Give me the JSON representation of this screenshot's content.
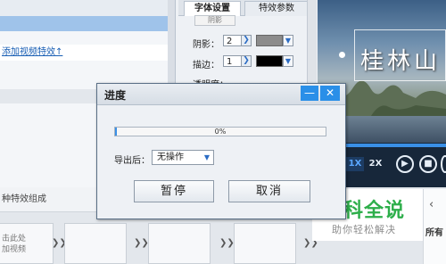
{
  "left_list": {
    "link_text": "添加视频特效↑"
  },
  "properties": {
    "tab_font": "字体设置",
    "tab_effect": "特效参数",
    "top_button": "阴影",
    "shadow_label": "阴影：",
    "shadow_value": "2",
    "shadow_color": "#8c8c8c",
    "stroke_label": "描边：",
    "stroke_value": "1",
    "stroke_color": "#000000",
    "opacity_label": "透明度："
  },
  "preview": {
    "title_text": "桂林山",
    "speed_1x": "1X",
    "speed_2x": "2X",
    "play_icon": "play-icon",
    "stop_icon": "stop-icon"
  },
  "bottom": {
    "effect_header": "种特效组成",
    "slot_hint": "击此处\n加视频"
  },
  "dialog": {
    "title": "进度",
    "progress_percent": 0,
    "progress_text": "0%",
    "after_label": "导出后：",
    "after_value": "无操作",
    "pause_button": "暂停",
    "cancel_button": "取消",
    "accent_color": "#2a8fe8"
  },
  "watermark": {
    "title": "百科全说",
    "subtitle": "助你轻松解决"
  },
  "right_strip": {
    "text": "所有"
  }
}
